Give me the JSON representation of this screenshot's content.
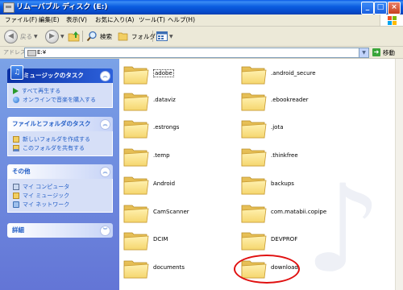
{
  "window": {
    "title": "リムーバブル ディスク (E:)"
  },
  "menu": [
    "ファイル(F)",
    "編集(E)",
    "表示(V)",
    "お気に入り(A)",
    "ツール(T)",
    "ヘルプ(H)"
  ],
  "toolbar": {
    "back": "戻る",
    "search": "検索",
    "folders": "フォルダ"
  },
  "address": {
    "label": "アドレス(D)",
    "value": "E:¥",
    "go": "移動"
  },
  "taskpane": {
    "music": {
      "title": "ミュージックのタスク",
      "items": [
        "すべて再生する",
        "オンラインで音楽を購入する"
      ]
    },
    "file": {
      "title": "ファイルとフォルダのタスク",
      "items": [
        "新しいフォルダを作成する",
        "このフォルダを共有する"
      ]
    },
    "other": {
      "title": "その他",
      "items": [
        "マイ コンピュータ",
        "マイ ミュージック",
        "マイ ネットワーク"
      ]
    },
    "details": {
      "title": "詳細"
    }
  },
  "folders": [
    "adobe",
    ".android_secure",
    ".dataviz",
    ".ebookreader",
    ".estrongs",
    ".jota",
    ".temp",
    ".thinkfree",
    "Android",
    "backups",
    "CamScanner",
    "com.matabii.copipe",
    "DCIM",
    "DEVPROF",
    "documents",
    "download"
  ],
  "colors": {
    "titlebar": "#0a58e6",
    "taskpane": "#6f8ee0",
    "folder": "#f5d66e",
    "highlight": "#e01010"
  }
}
